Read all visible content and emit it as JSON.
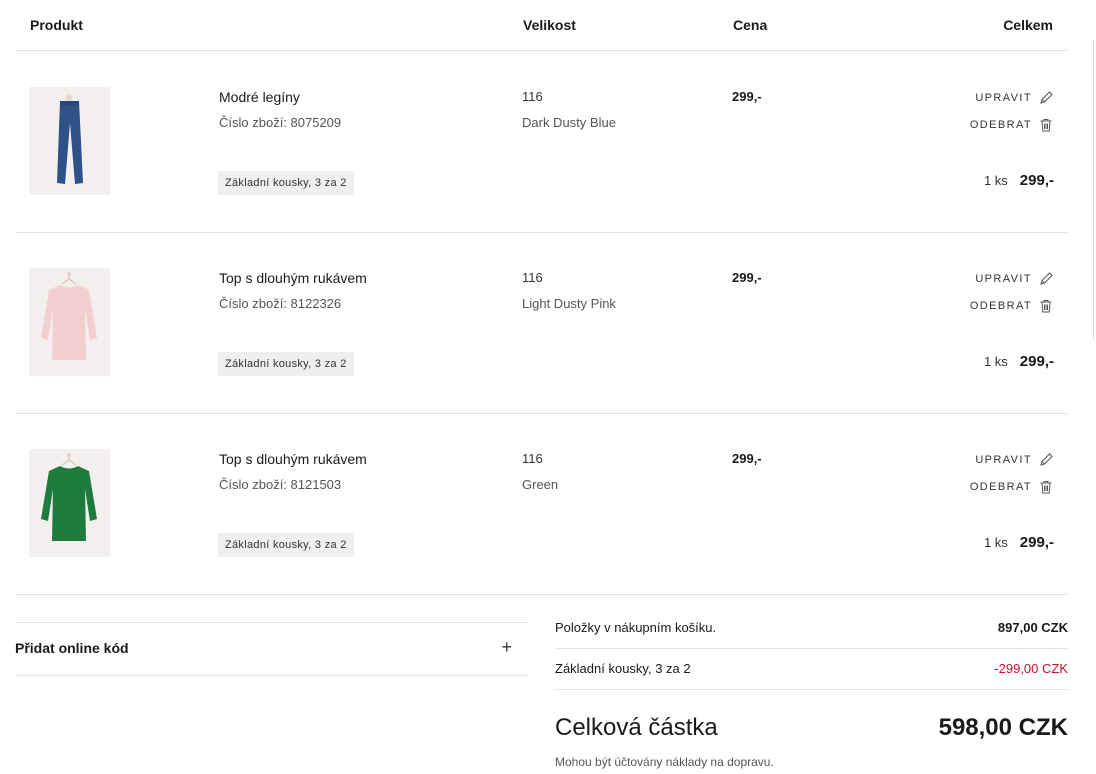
{
  "table_header": {
    "product": "Produkt",
    "size": "Velikost",
    "price": "Cena",
    "total": "Celkem"
  },
  "items": [
    {
      "name": "Modré legíny",
      "sku": "Číslo zboží: 8075209",
      "promo": "Základní kousky, 3 za 2",
      "size": "116",
      "color": "Dark Dusty Blue",
      "price": "299,-",
      "edit_label": "UPRAVIT",
      "remove_label": "ODEBRAT",
      "qty": "1 ks",
      "line_total": "299,-",
      "image_icon": "leggings-image",
      "image_color": "#2e5187"
    },
    {
      "name": "Top s dlouhým rukávem",
      "sku": "Číslo zboží: 8122326",
      "promo": "Základní kousky, 3 za 2",
      "size": "116",
      "color": "Light Dusty Pink",
      "price": "299,-",
      "edit_label": "UPRAVIT",
      "remove_label": "ODEBRAT",
      "qty": "1 ks",
      "line_total": "299,-",
      "image_icon": "top-image",
      "image_color": "#f4cfd0"
    },
    {
      "name": "Top s dlouhým rukávem",
      "sku": "Číslo zboží: 8121503",
      "promo": "Základní kousky, 3 za 2",
      "size": "116",
      "color": "Green",
      "price": "299,-",
      "edit_label": "UPRAVIT",
      "remove_label": "ODEBRAT",
      "qty": "1 ks",
      "line_total": "299,-",
      "image_icon": "top-image",
      "image_color": "#1f7a3e"
    }
  ],
  "promo_code": {
    "label": "Přidat online kód",
    "toggle": "+"
  },
  "summary": {
    "items_label": "Položky v nákupním košíku.",
    "items_value": "897,00 CZK",
    "discount_label": "Základní kousky, 3 za 2",
    "discount_value": "-299,00 CZK",
    "total_label": "Celková částka",
    "total_value": "598,00 CZK",
    "shipping_note": "Mohou být účtovány náklady na dopravu."
  },
  "colors": {
    "discount": "#c8102e",
    "divider": "#e2e2e2",
    "promo_badge_bg": "#efefef"
  }
}
